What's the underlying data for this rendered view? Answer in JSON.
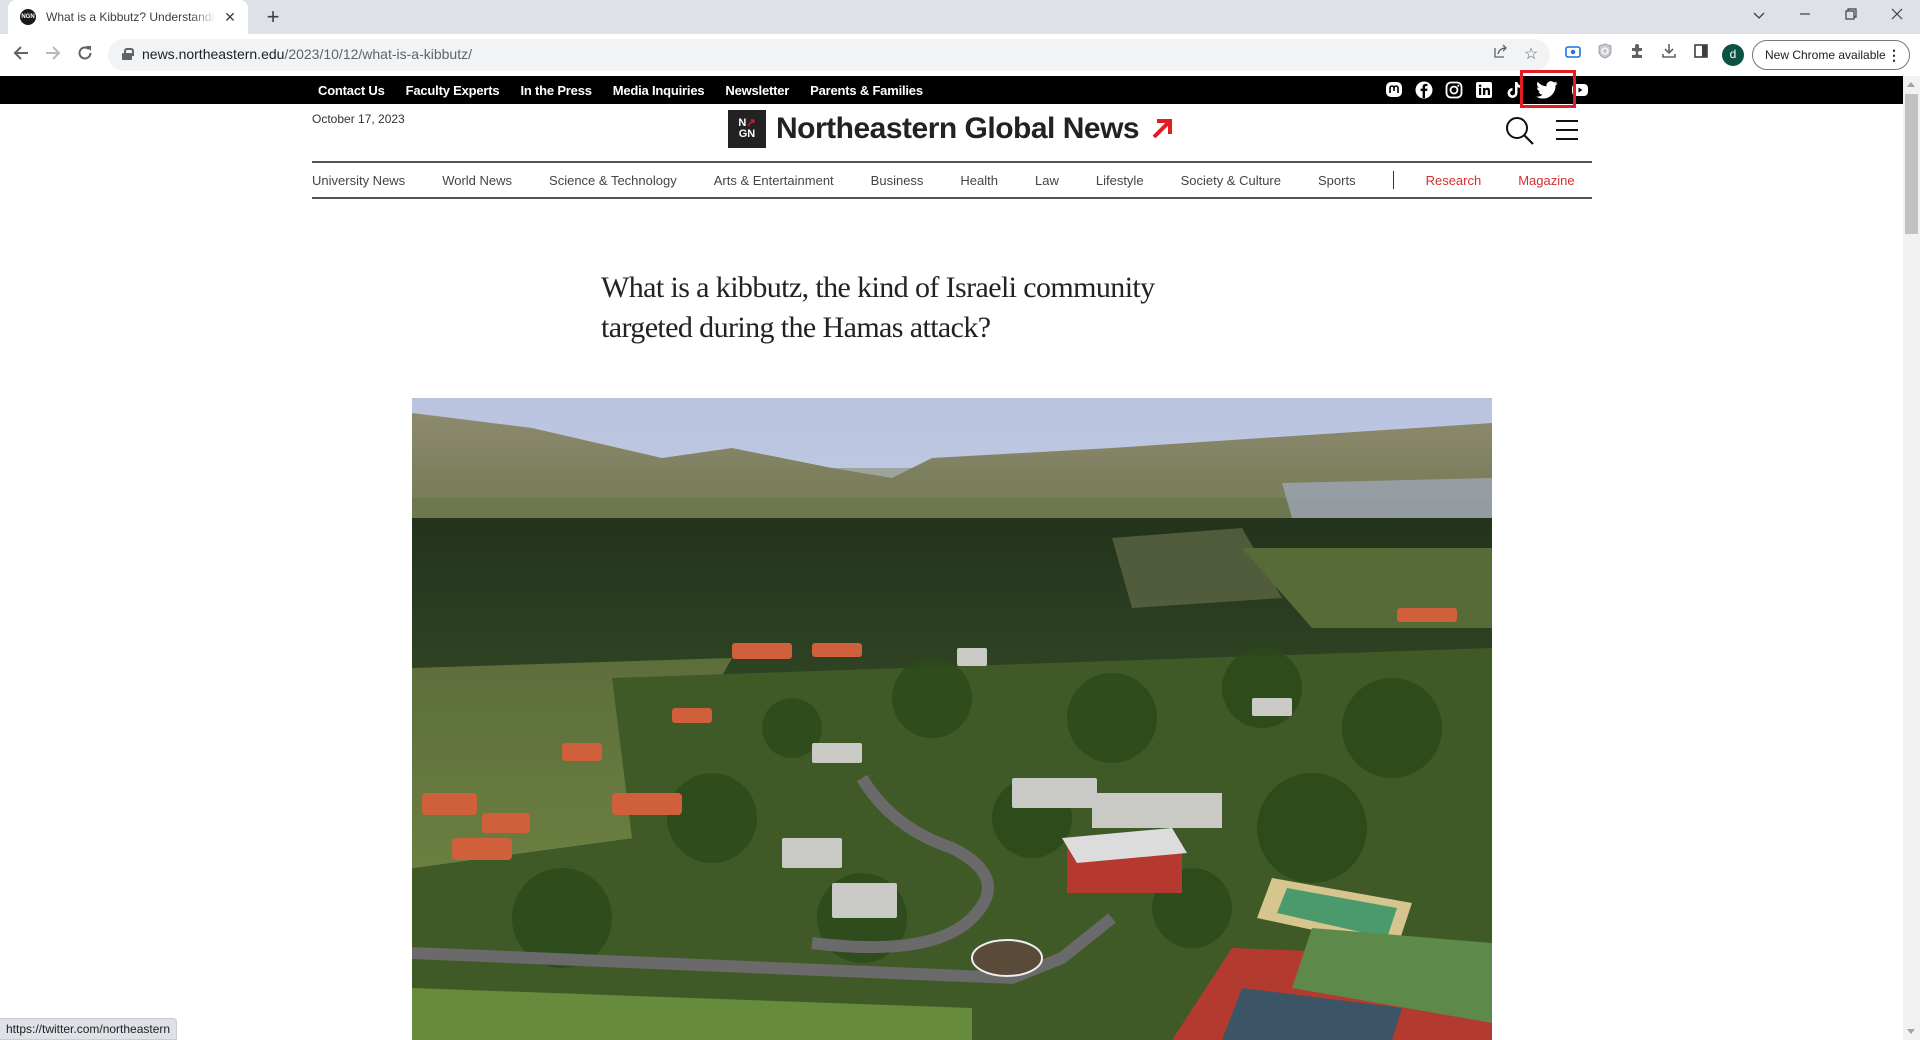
{
  "browser": {
    "tab": {
      "title": "What is a Kibbutz? Understanding",
      "favicon_text": "NGN"
    },
    "new_tab_label": "+",
    "address": {
      "domain": "news.northeastern.edu",
      "path": "/2023/10/12/what-is-a-kibbutz/"
    },
    "profile_initial": "d",
    "update_button": "New Chrome available",
    "status_url": "https://twitter.com/northeastern",
    "icons": [
      "back-icon",
      "forward-icon",
      "reload-icon",
      "lock-icon",
      "share-icon",
      "star-icon",
      "screencast-icon",
      "shield-extension-icon",
      "extensions-icon",
      "download-icon",
      "side-panel-icon"
    ]
  },
  "site": {
    "top_links": [
      "Contact Us",
      "Faculty Experts",
      "In the Press",
      "Media Inquiries",
      "Newsletter",
      "Parents & Families"
    ],
    "social": [
      "mastodon",
      "facebook",
      "instagram",
      "linkedin",
      "tiktok",
      "twitter",
      "youtube"
    ],
    "highlighted_social": "twitter",
    "highlight_color": "#e31c24",
    "date": "October 17, 2023",
    "logo": {
      "mark_top": "N",
      "mark_bottom": "GN",
      "name": "Northeastern Global News",
      "accent": "#e31c24"
    },
    "categories": [
      "University News",
      "World News",
      "Science & Technology",
      "Arts & Entertainment",
      "Business",
      "Health",
      "Law",
      "Lifestyle",
      "Society & Culture",
      "Sports"
    ],
    "highlight_categories": [
      "Research",
      "Magazine"
    ],
    "highlight_category_color": "#d4302f"
  },
  "article": {
    "headline": "What is a kibbutz, the kind of Israeli community targeted during the Hamas attack?",
    "hero_alt": "Aerial view of a kibbutz with red-roofed houses, trees, roads and hills in the background"
  }
}
